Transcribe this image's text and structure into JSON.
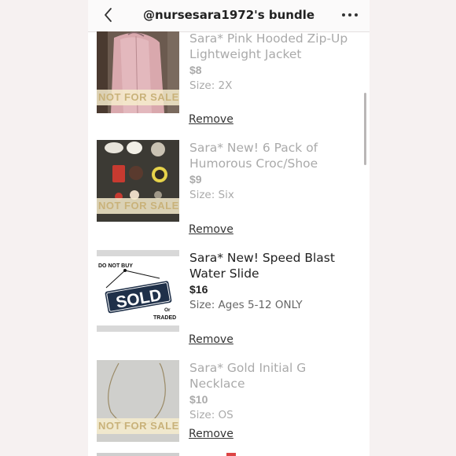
{
  "header": {
    "title": "@nursesara1972's bundle",
    "back_icon": "chevron-left-icon",
    "more_icon": "more-horizontal-icon"
  },
  "items": [
    {
      "name_line1": "Sara* Pink Hooded Zip-Up",
      "name_line2": "Lightweight Jacket",
      "price": "$8",
      "size": "Size: 2X",
      "badge": "NOT FOR SALE",
      "remove": "Remove"
    },
    {
      "name_line1": "Sara* New! 6 Pack of",
      "name_line2": "Humorous Croc/Shoe",
      "price": "$9",
      "size": "Size: Six",
      "badge": "NOT FOR SALE",
      "remove": "Remove"
    },
    {
      "name_line1": "Sara* New! Speed Blast",
      "name_line2": "Water Slide",
      "price": "$16",
      "size": "Size: Ages 5-12 ONLY",
      "remove": "Remove",
      "sign": {
        "top": "DO NOT BUY",
        "main": "SOLD",
        "or": "Or",
        "traded": "TRADED"
      }
    },
    {
      "name_line1": "Sara* Gold Initial G Necklace",
      "price": "$10",
      "size": "Size: OS",
      "badge": "NOT FOR SALE",
      "remove": "Remove"
    }
  ],
  "colors": {
    "badge_bg": "#f6eccd",
    "badge_text": "#c9b27a",
    "sold_sign": "#1f3049",
    "muted_text": "#aaaaaa"
  }
}
